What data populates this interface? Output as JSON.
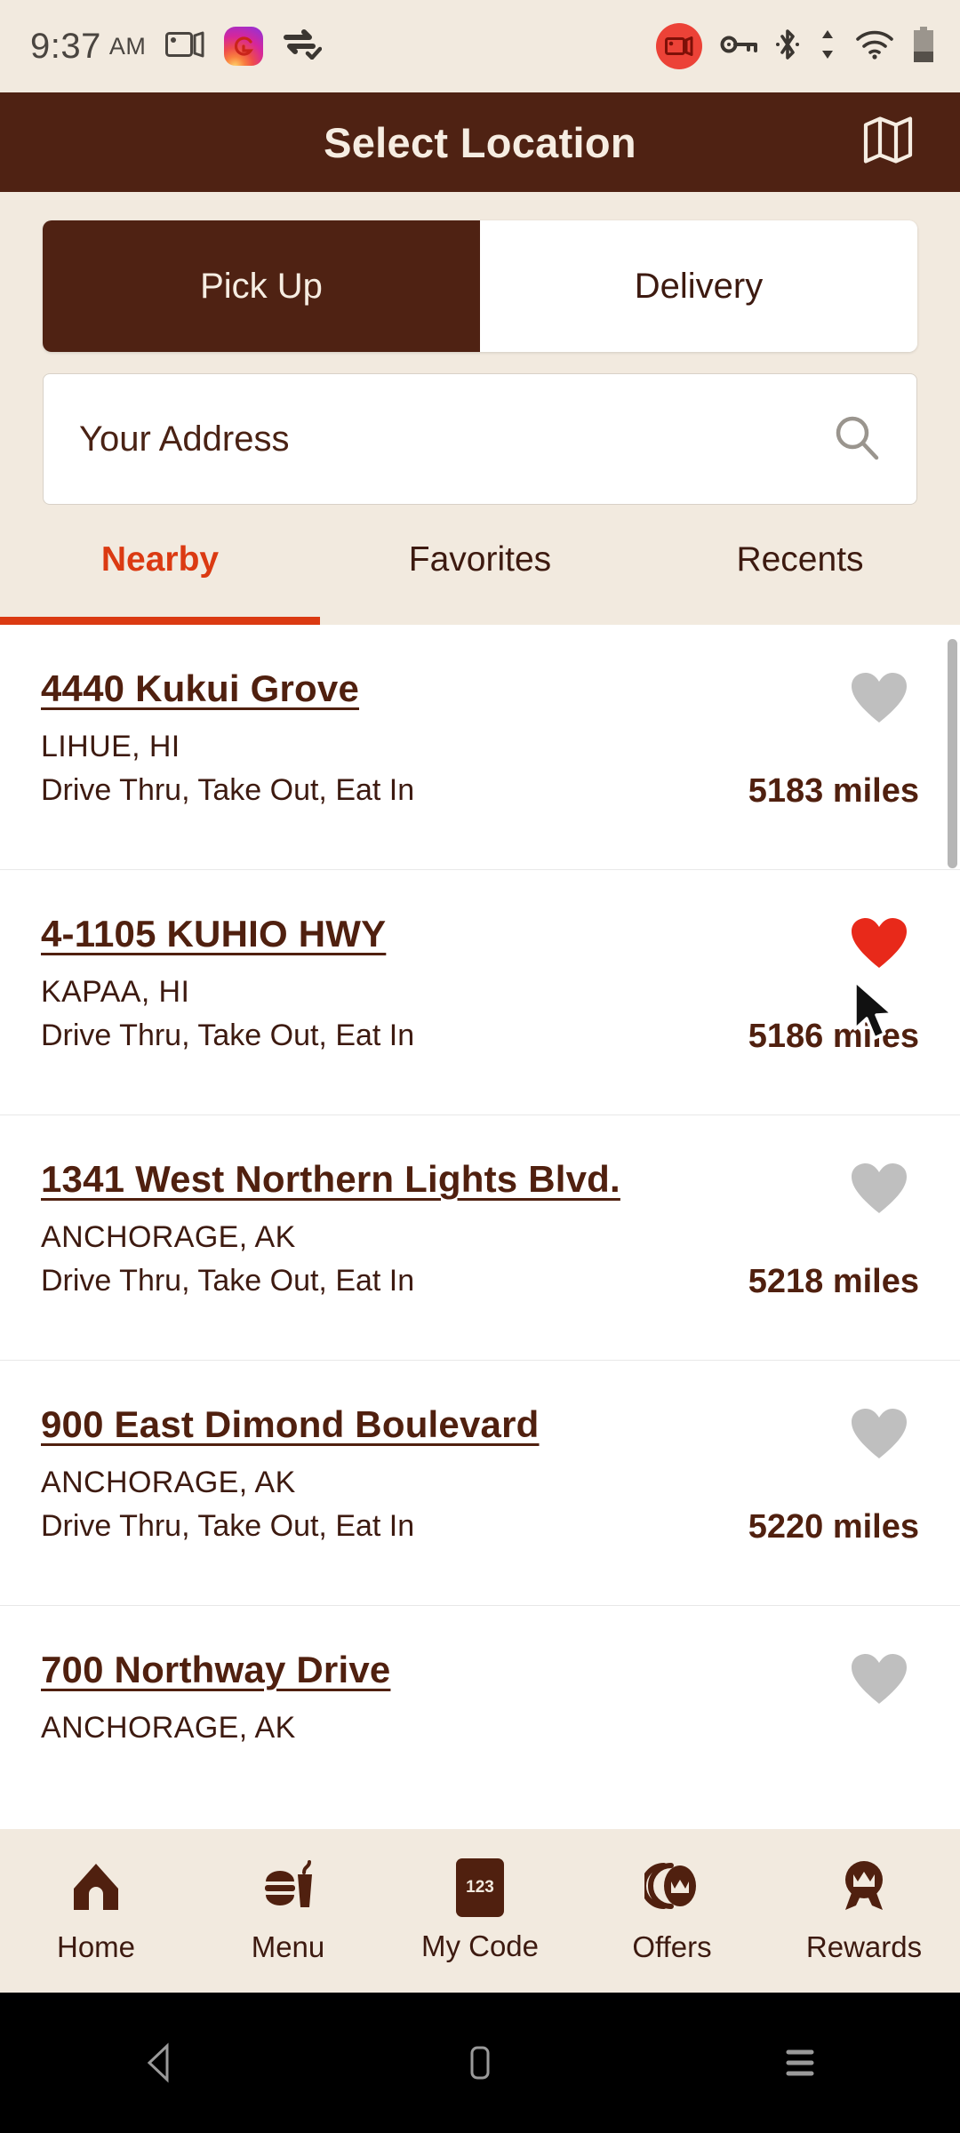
{
  "status_bar": {
    "time": "9:37",
    "meridiem": "AM",
    "left_icons": [
      "screen-cast-icon",
      "instagram-icon",
      "usb-data-transfer-icon"
    ],
    "right_icons": [
      "screen-record-icon",
      "vpn-key-icon",
      "bluetooth-icon",
      "data-transfer-icon",
      "wifi-icon",
      "battery-icon"
    ],
    "record_badge_color": "#EC4237",
    "text_color": "#4A4540",
    "background": "#F2EADF"
  },
  "header": {
    "title": "Select Location",
    "map_icon": "map-icon",
    "background": "#4F2213",
    "text_color": "#F6EDE2"
  },
  "order_mode_toggle": {
    "options": [
      {
        "label": "Pick Up",
        "selected": true
      },
      {
        "label": "Delivery",
        "selected": false
      }
    ]
  },
  "search": {
    "value": "",
    "placeholder": "Your Address",
    "icon": "search-icon"
  },
  "tabs": {
    "items": [
      {
        "label": "Nearby",
        "active": true
      },
      {
        "label": "Favorites",
        "active": false
      },
      {
        "label": "Recents",
        "active": false
      }
    ],
    "active_color": "#DB3A12",
    "inactive_color": "#3D1A10"
  },
  "locations": [
    {
      "address": "4440 Kukui Grove",
      "city": "LIHUE, HI",
      "services": "Drive Thru, Take Out, Eat In",
      "distance": "5183 miles",
      "favorite": false
    },
    {
      "address": "4-1105 KUHIO HWY",
      "city": "KAPAA, HI",
      "services": "Drive Thru, Take Out, Eat In",
      "distance": "5186 miles",
      "favorite": true
    },
    {
      "address": "1341 West Northern Lights Blvd.",
      "city": "ANCHORAGE, AK",
      "services": "Drive Thru, Take Out, Eat In",
      "distance": "5218 miles",
      "favorite": false
    },
    {
      "address": "900 East Dimond Boulevard",
      "city": "ANCHORAGE, AK",
      "services": "Drive Thru, Take Out, Eat In",
      "distance": "5220 miles",
      "favorite": false
    },
    {
      "address": "700 Northway Drive",
      "city": "ANCHORAGE, AK",
      "services": "",
      "distance": "",
      "favorite": false
    }
  ],
  "favorite_colors": {
    "on": "#E8291A",
    "off": "#BFBFBF"
  },
  "bottom_nav": {
    "items": [
      {
        "label": "Home",
        "icon": "home-icon"
      },
      {
        "label": "Menu",
        "icon": "burger-drink-icon"
      },
      {
        "label": "My Code",
        "icon": "code-card-icon",
        "chip_text": "123"
      },
      {
        "label": "Offers",
        "icon": "offers-crown-icon"
      },
      {
        "label": "Rewards",
        "icon": "rewards-ribbon-icon"
      }
    ],
    "background": "#F2EADF",
    "icon_color": "#50200F"
  },
  "android_nav": {
    "buttons": [
      "back-icon",
      "home-icon",
      "recents-icon"
    ],
    "background": "#000000"
  }
}
